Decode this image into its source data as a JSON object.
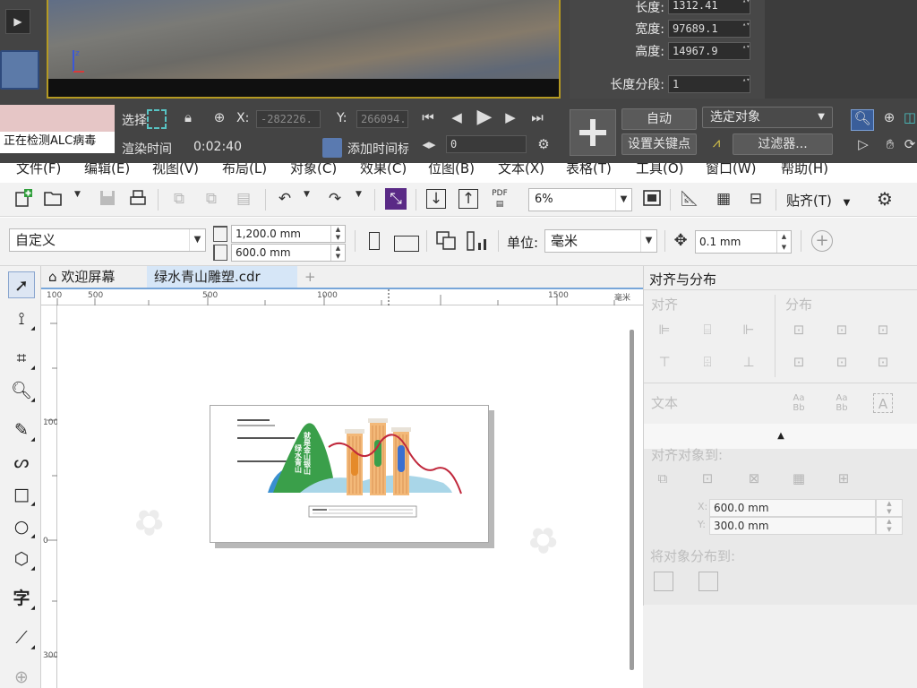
{
  "max": {
    "props": [
      {
        "label": "长度:",
        "value": "1312.41"
      },
      {
        "label": "宽度:",
        "value": "97689.1"
      },
      {
        "label": "高度:",
        "value": "14967.9"
      }
    ],
    "length_segments": {
      "label": "长度分段:",
      "value": "1"
    },
    "status_text": "正在检测ALC病毒",
    "select_label": "选择",
    "x_label": "X:",
    "x_value": "-282226.",
    "y_label": "Y:",
    "y_value": "266094.",
    "render_time_label": "渲染时间",
    "render_time_value": "0:02:40",
    "add_time_tag": "添加时间标记",
    "frame_value": "0",
    "auto_button": "自动",
    "set_key_button": "设置关键点",
    "selected_object": "选定对象",
    "filters_button": "过滤器..."
  },
  "menu": [
    "文件(F)",
    "编辑(E)",
    "视图(V)",
    "布局(L)",
    "对象(C)",
    "效果(C)",
    "位图(B)",
    "文本(X)",
    "表格(T)",
    "工具(O)",
    "窗口(W)",
    "帮助(H)"
  ],
  "toolbar": {
    "zoom": "6%",
    "snap_label": "贴齐(T)",
    "pdf_label": "PDF"
  },
  "propbar": {
    "page_preset": "自定义",
    "width": "1,200.0 mm",
    "height": "600.0 mm",
    "units_label": "单位:",
    "units_value": "毫米",
    "nudge": "0.1 mm"
  },
  "tabs": {
    "welcome": "欢迎屏幕",
    "document": "绿水青山雕塑.cdr",
    "add": "+"
  },
  "ruler": {
    "h_labels": [
      "100",
      "500",
      "1000",
      "1500",
      "毫米"
    ],
    "v_labels": [
      "100",
      "300",
      "0"
    ]
  },
  "artwork": {
    "vertical_text_1": "就是金山银山",
    "vertical_text_2": "绿水青山"
  },
  "docker": {
    "title": "对齐与分布",
    "align_label": "对齐",
    "distribute_label": "分布",
    "text_label": "文本",
    "align_to_label": "对齐对象到:",
    "x_label": "X:",
    "x_value": "600.0 mm",
    "y_label": "Y:",
    "y_value": "300.0 mm",
    "distribute_to_label": "将对象分布到:"
  },
  "colors": {
    "max_bg": "#444444",
    "corel_bg": "#f2f2f2",
    "accent": "#78a6d9",
    "mountain_green": "#3a9f4a",
    "water_blue": "#3a8fd0",
    "pillar_orange": "#f0b070",
    "ribbon_red": "#c0283c"
  }
}
